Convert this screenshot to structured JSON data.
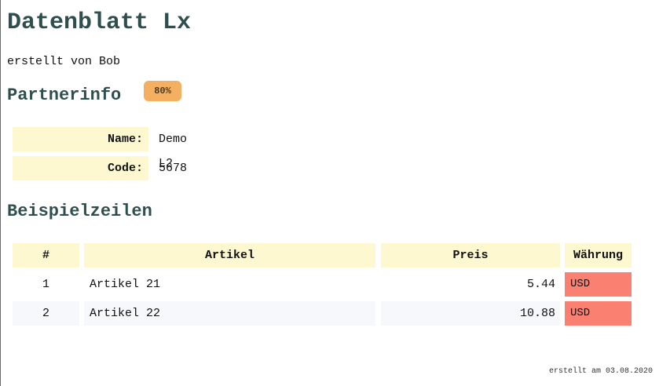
{
  "document": {
    "title": "Datenblatt Lx",
    "subtitle": "erstellt von Bob",
    "footer": "erstellt am 03.08.2020"
  },
  "partner": {
    "heading": "Partnerinfo",
    "badge": "80%",
    "fields": [
      {
        "label": "Name:",
        "value": "Demo L2"
      },
      {
        "label": "Code:",
        "value": "5678"
      }
    ]
  },
  "examples": {
    "heading": "Beispielzeilen",
    "columns": [
      "#",
      "Artikel",
      "Preis",
      "Währung"
    ],
    "rows": [
      {
        "num": "1",
        "article": "Artikel 21",
        "price": "5.44",
        "currency": "USD"
      },
      {
        "num": "2",
        "article": "Artikel 22",
        "price": "10.88",
        "currency": "USD"
      }
    ]
  },
  "colors": {
    "heading": "#2f4f4f",
    "label_bg": "#fdf8d0",
    "badge_bg": "#f4b060",
    "currency_bg": "#fa8072",
    "alt_row_bg": "#f6f8fc"
  }
}
